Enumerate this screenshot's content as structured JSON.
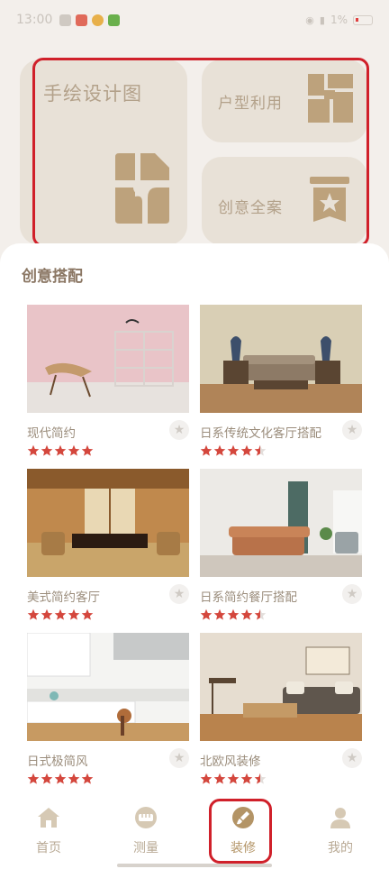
{
  "status_bar": {
    "time": "13:00",
    "network": "1%"
  },
  "hero": {
    "hand_drawn_label": "手绘设计图",
    "floor_plan_label": "户型利用",
    "full_case_label": "创意全案"
  },
  "section": {
    "title": "创意搭配"
  },
  "items": [
    {
      "name": "现代简约",
      "rating": 5
    },
    {
      "name": "日系传统文化客厅搭配",
      "rating": 4.5
    },
    {
      "name": "美式简约客厅",
      "rating": 5
    },
    {
      "name": "日系简约餐厅搭配",
      "rating": 4.5
    },
    {
      "name": "日式极简风",
      "rating": 5
    },
    {
      "name": "北欧风装修",
      "rating": 4.5
    }
  ],
  "nav": {
    "home": "首页",
    "measure": "测量",
    "decorate": "装修",
    "mine": "我的",
    "active": "装修"
  },
  "colors": {
    "accent": "#b39466",
    "card_bg": "#e8e1d7",
    "star": "#d4473d",
    "highlight": "#d0202a"
  }
}
